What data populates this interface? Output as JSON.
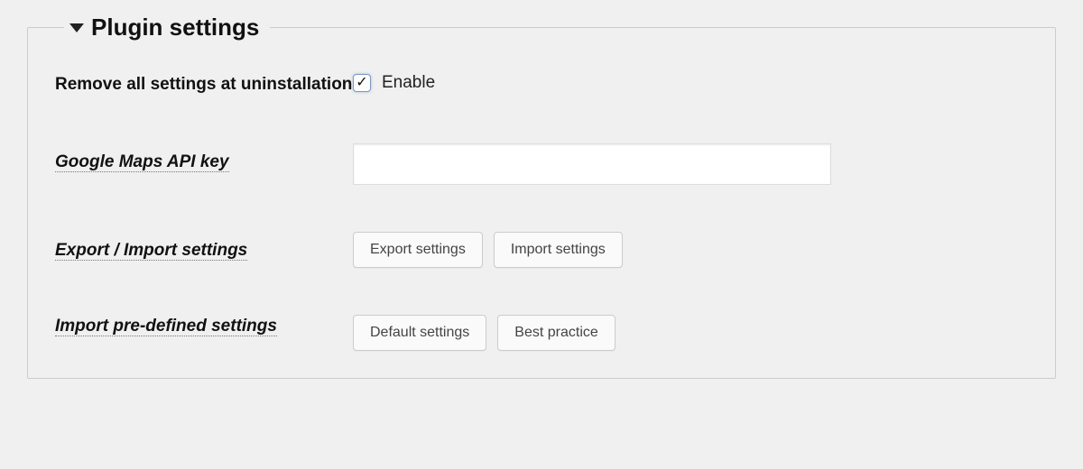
{
  "fieldset": {
    "legend": "Plugin settings"
  },
  "rows": {
    "remove_settings": {
      "label": "Remove all settings at uninstallation",
      "checkbox_checked": true,
      "checkbox_label": "Enable"
    },
    "api_key": {
      "label": "Google Maps API key",
      "value": ""
    },
    "export_import": {
      "label": "Export / Import settings",
      "export_btn": "Export settings",
      "import_btn": "Import settings"
    },
    "predefined": {
      "label": "Import pre-defined settings",
      "default_btn": "Default settings",
      "best_btn": "Best practice"
    }
  }
}
